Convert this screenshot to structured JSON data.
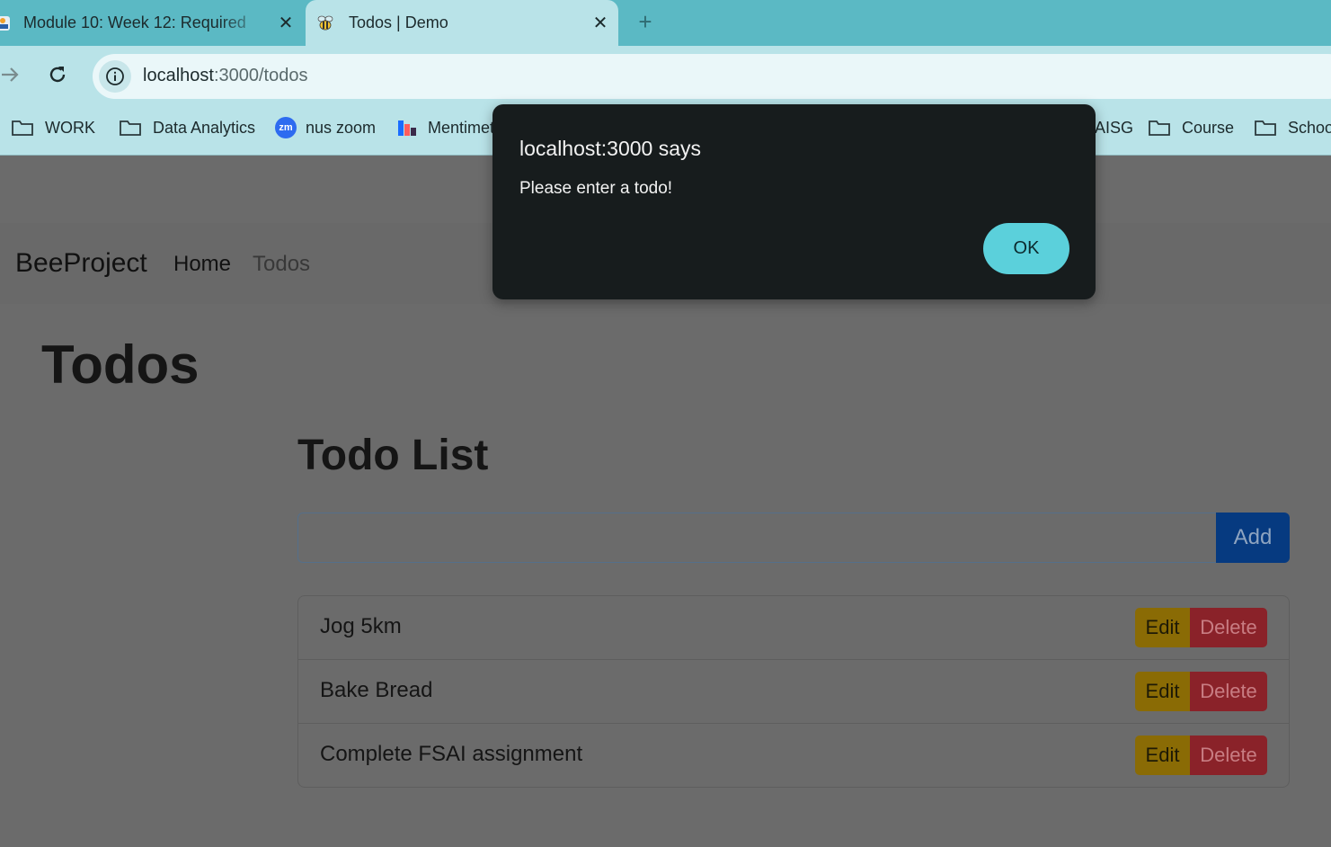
{
  "browser": {
    "tabs": [
      {
        "title": "Module 10: Week 12: Required",
        "active": false
      },
      {
        "title": "Todos | Demo",
        "active": true
      }
    ],
    "close_glyph": "✕",
    "new_tab_glyph": "+",
    "url_host": "localhost",
    "url_path": ":3000/todos",
    "bookmarks": [
      {
        "label": "WORK",
        "icon": "folder-icon"
      },
      {
        "label": "Data Analytics",
        "icon": "folder-icon"
      },
      {
        "label": "nus zoom",
        "icon": "zoom-icon"
      },
      {
        "label": "Mentimeter",
        "icon": "mentimeter-icon"
      },
      {
        "label": "AISG",
        "icon": "folder-icon"
      },
      {
        "label": "Course",
        "icon": "folder-icon"
      },
      {
        "label": "School",
        "icon": "folder-icon"
      }
    ],
    "zoom_badge": "zm"
  },
  "navbar": {
    "brand": "BeeProject",
    "links": [
      "Home",
      "Todos"
    ]
  },
  "main": {
    "heading": "Todos",
    "list_heading": "Todo List",
    "input_value": "",
    "add_label": "Add",
    "items": [
      {
        "text": "Jog 5km",
        "edit_label": "Edit",
        "delete_label": "Delete"
      },
      {
        "text": "Bake Bread",
        "edit_label": "Edit",
        "delete_label": "Delete"
      },
      {
        "text": "Complete FSAI assignment",
        "edit_label": "Edit",
        "delete_label": "Delete"
      }
    ]
  },
  "dialog": {
    "title": "localhost:3000 says",
    "message": "Please enter a todo!",
    "ok_label": "OK"
  },
  "colors": {
    "tab_bar": "#5bb9c4",
    "toolbar": "#b9e3e8",
    "dialog_bg": "#171c1d",
    "ok_button": "#5bd0db",
    "add_button": "#063a80",
    "edit_button": "#8a6b05",
    "delete_button": "#8a2229",
    "overlay": "#6b6b6b"
  }
}
